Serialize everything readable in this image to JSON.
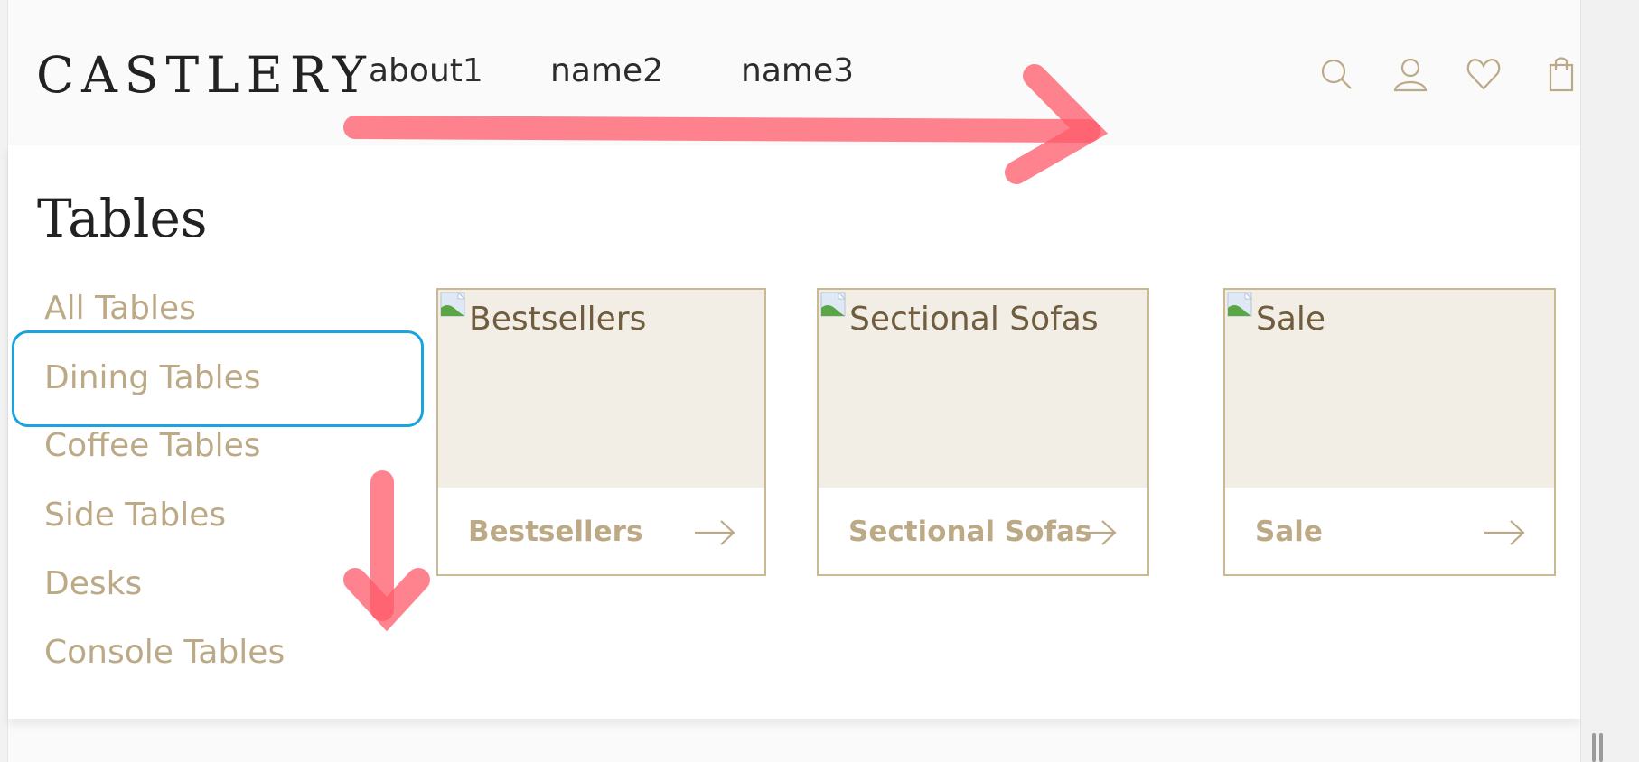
{
  "brand": {
    "logo_text": "CASTLERY"
  },
  "nav": {
    "items": [
      "about1",
      "name2",
      "name3"
    ]
  },
  "header_icons": [
    "search-icon",
    "account-icon",
    "heart-icon",
    "bag-icon"
  ],
  "panel": {
    "title": "Tables",
    "categories": [
      "All Tables",
      "Dining Tables",
      "Coffee Tables",
      "Side Tables",
      "Desks",
      "Console Tables"
    ],
    "highlighted_category": "Dining Tables",
    "cards": [
      {
        "image_alt": "Bestsellers",
        "label": "Bestsellers"
      },
      {
        "image_alt": "Sectional Sofas",
        "label": "Sectional Sofas"
      },
      {
        "image_alt": "Sale",
        "label": "Sale"
      }
    ]
  },
  "colors": {
    "accent_gold": "#bca986",
    "card_border": "#cbb992",
    "card_image_bg": "#f3eee5",
    "highlight_blue": "#1aa3e0",
    "annotation_red": "#ff5a6a"
  }
}
